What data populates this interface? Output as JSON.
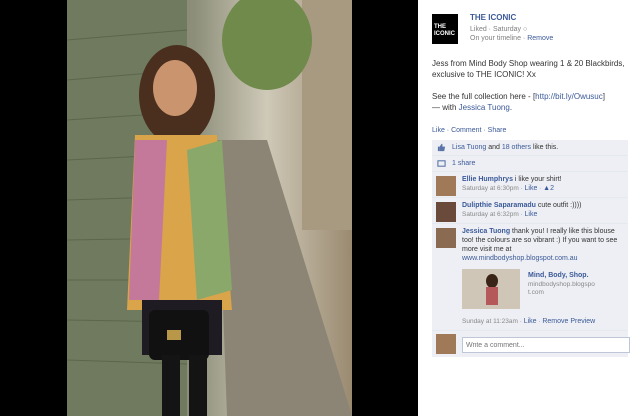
{
  "page": {
    "name": "THE ICONIC",
    "logo_text": "THE ICONIC",
    "liked": "Liked",
    "sep": " · ",
    "date": "Saturday",
    "timeline": "On your timeline",
    "remove": "Remove"
  },
  "post": {
    "line1": "Jess from Mind Body Shop wearing 1 & 20 Blackbirds, exclusive to THE ICONIC! Xx",
    "line2_prefix": "See the full collection here - [",
    "line2_link": "http://bit.ly/Owusuc",
    "line2_suffix": "]",
    "with_prefix": "— with ",
    "with_name": "Jessica Tuong",
    "with_suffix": "."
  },
  "actions": {
    "like": "Like",
    "comment": "Comment",
    "share": "Share",
    "dot": " · "
  },
  "likes": {
    "name": "Lisa Tuong",
    "and": " and ",
    "others": "18 others",
    "suffix": " like this."
  },
  "shares": {
    "label": "1 share"
  },
  "comments": [
    {
      "author": "Ellie Humphrys",
      "text": " i like your shirt!",
      "time": "Saturday at 6:30pm",
      "like": "Like",
      "likes_count": "2"
    },
    {
      "author": "Dulipthie Saparamadu",
      "text": " cute outfit :))))",
      "time": "Saturday at 6:32pm",
      "like": "Like"
    },
    {
      "author": "Jessica Tuong",
      "text": " thank you! I really like this blouse too! the colours are so vibrant :) If you want to see more visit me at",
      "url": "www.mindbodyshop.blogspot.com.au",
      "preview_title": "Mind, Body, Shop.",
      "preview_url": "mindbodyshop.blogspot.com",
      "time": "Sunday at 11:23am",
      "like": "Like",
      "remove_preview": "Remove Preview"
    }
  ],
  "write_comment": {
    "placeholder": "Write a comment..."
  }
}
